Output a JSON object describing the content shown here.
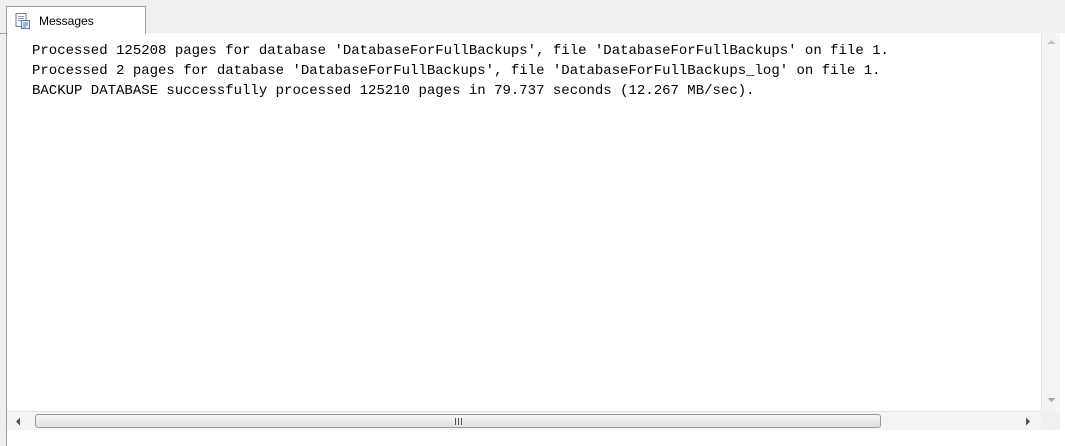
{
  "tabs": [
    {
      "label": "Messages",
      "icon": "messages-icon",
      "active": true
    }
  ],
  "messages": [
    "Processed 125208 pages for database 'DatabaseForFullBackups', file 'DatabaseForFullBackups' on file 1.",
    "Processed 2 pages for database 'DatabaseForFullBackups', file 'DatabaseForFullBackups_log' on file 1.",
    "BACKUP DATABASE successfully processed 125210 pages in 79.737 seconds (12.267 MB/sec)."
  ],
  "colors": {
    "chrome": "#f0f0f0",
    "border": "#a0a0a0",
    "text": "#000000"
  }
}
